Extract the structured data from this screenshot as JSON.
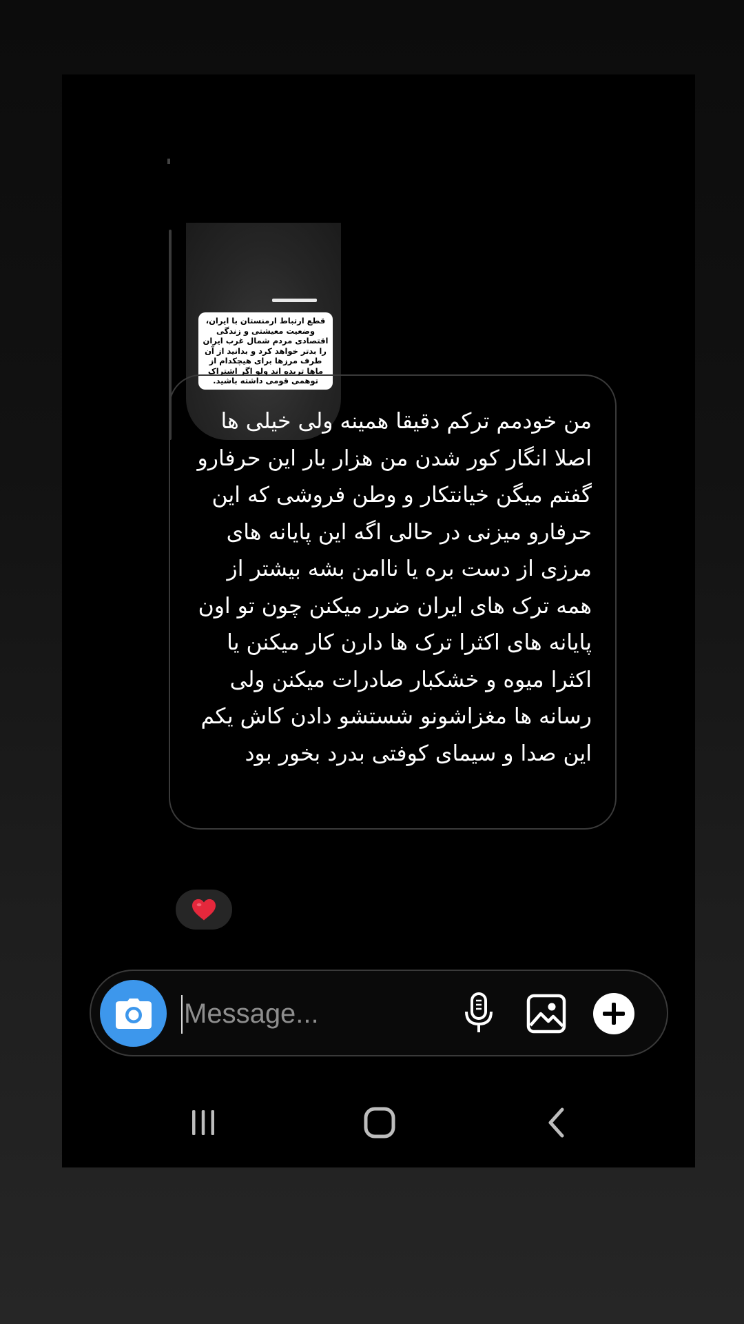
{
  "story_reply": {
    "caption": "قطع ارتباط ارمنستان با ایران، وضعیت معیشتی و زندگی اقتصادی مردم شمال غرب ایران را بدتر خواهد کرد و بدانید از آن طرف مرزها برای هیچکدام از ماها تریده اند ولو اگر اشتراک توهمی قومی داشته باشید."
  },
  "message": {
    "text": "من خودمم ترکم دقیقا همینه ولی خیلی ها اصلا انگار کور شدن من هزار بار این حرفارو گفتم میگن خیانتکار و وطن فروشی که این حرفارو میزنی در حالی اگه این پایانه های مرزی از دست بره یا ناامن بشه بیشتر از همه ترک های ایران ضرر میکنن چون تو اون پایانه های اکثرا ترک ها دارن کار میکنن یا اکثرا میوه و خشکبار صادرات میکنن ولی رسانه ها مغزاشونو شستشو دادن کاش یکم این صدا و سیمای کوفتی بدرد بخور بود",
    "reaction_icon": "heart-icon",
    "reaction_color": "#e5283c"
  },
  "composer": {
    "placeholder": "Message...",
    "value": "",
    "camera_color": "#3d97ec"
  },
  "nav": {
    "recents_icon": "recents-icon",
    "home_icon": "home-icon",
    "back_icon": "back-icon"
  }
}
